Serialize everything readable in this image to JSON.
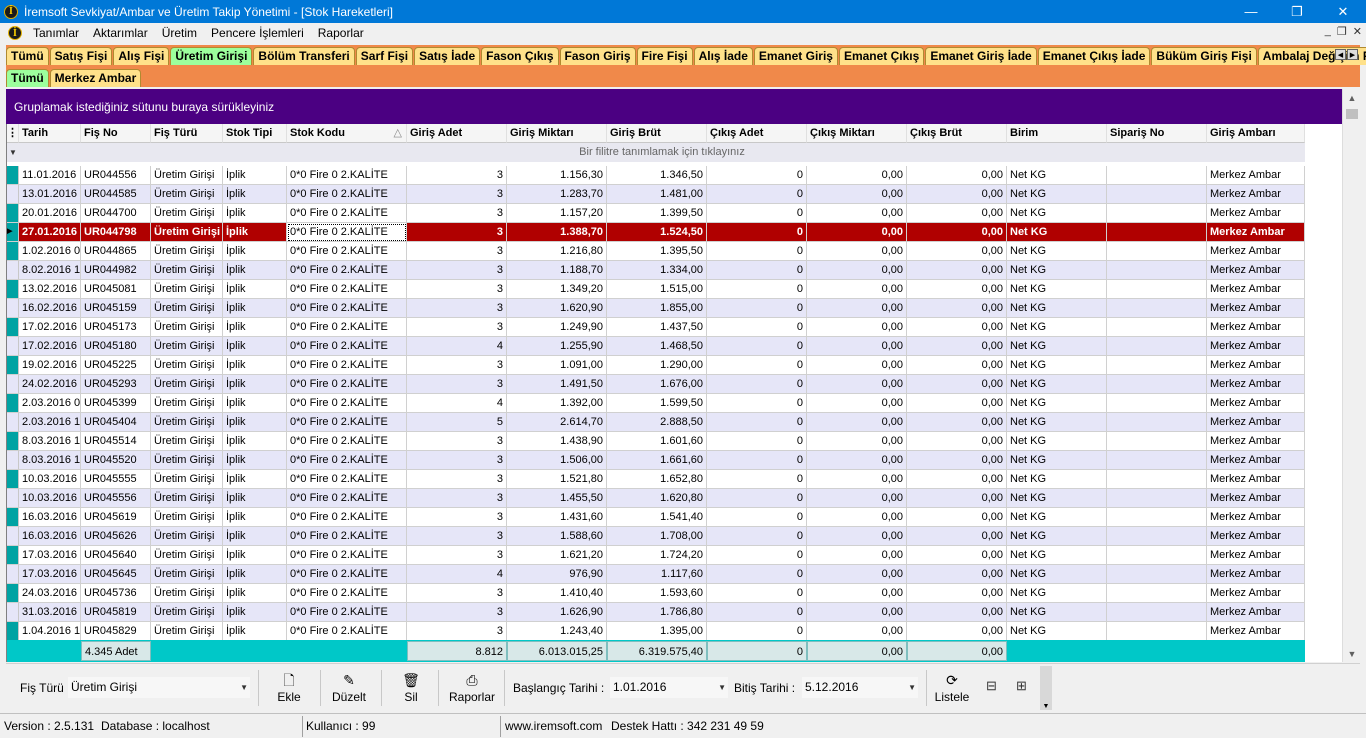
{
  "window": {
    "title": "İremsoft Sevkiyat/Ambar ve Üretim Takip Yönetimi - [Stok Hareketleri]",
    "minimize": "—",
    "maximize": "❐",
    "close": "✕"
  },
  "menu": [
    "Tanımlar",
    "Aktarımlar",
    "Üretim",
    "Pencere İşlemleri",
    "Raporlar"
  ],
  "mdi": {
    "minimize": "_",
    "restore": "❐",
    "close": "✕"
  },
  "tabs_row1": [
    "Tümü",
    "Satış Fişi",
    "Alış Fişi",
    "Üretim Girişi",
    "Bölüm Transferi",
    "Sarf Fişi",
    "Satış İade",
    "Fason Çıkış",
    "Fason Giriş",
    "Fire Fişi",
    "Alış İade",
    "Emanet Giriş",
    "Emanet Çıkış",
    "Emanet Giriş İade",
    "Emanet Çıkış İade",
    "Büküm Giriş Fişi",
    "Ambalaj Değişim Fişi"
  ],
  "tabs_row1_active": 3,
  "tabs_row2": [
    "Tümü",
    "Merkez Ambar"
  ],
  "tabs_row2_active": 0,
  "group_panel": "Gruplamak istediğiniz sütunu buraya sürükleyiniz",
  "filter_text": "Bir filitre tanımlamak için tıklayınız",
  "columns": [
    "Tarih",
    "Fiş No",
    "Fiş Türü",
    "Stok Tipi",
    "Stok Kodu",
    "Giriş Adet",
    "Giriş Miktarı",
    "Giriş Brüt",
    "Çıkış Adet",
    "Çıkış Miktarı",
    "Çıkış Brüt",
    "Birim",
    "Sipariş No",
    "Giriş Ambarı"
  ],
  "sort_indicator": "△",
  "selected_row": 3,
  "rows": [
    [
      "11.01.2016",
      "UR044556",
      "Üretim Girişi",
      "İplik",
      "0*0 Fire 0 2.KALİTE",
      "3",
      "1.156,30",
      "1.346,50",
      "0",
      "0,00",
      "0,00",
      "Net KG",
      "",
      "Merkez Ambar"
    ],
    [
      "13.01.2016",
      "UR044585",
      "Üretim Girişi",
      "İplik",
      "0*0 Fire 0 2.KALİTE",
      "3",
      "1.283,70",
      "1.481,00",
      "0",
      "0,00",
      "0,00",
      "Net KG",
      "",
      "Merkez Ambar"
    ],
    [
      "20.01.2016",
      "UR044700",
      "Üretim Girişi",
      "İplik",
      "0*0 Fire 0 2.KALİTE",
      "3",
      "1.157,20",
      "1.399,50",
      "0",
      "0,00",
      "0,00",
      "Net KG",
      "",
      "Merkez Ambar"
    ],
    [
      "27.01.2016",
      "UR044798",
      "Üretim Girişi",
      "İplik",
      "0*0 Fire 0 2.KALİTE",
      "3",
      "1.388,70",
      "1.524,50",
      "0",
      "0,00",
      "0,00",
      "Net KG",
      "",
      "Merkez Ambar"
    ],
    [
      "1.02.2016 0",
      "UR044865",
      "Üretim Girişi",
      "İplik",
      "0*0 Fire 0 2.KALİTE",
      "3",
      "1.216,80",
      "1.395,50",
      "0",
      "0,00",
      "0,00",
      "Net KG",
      "",
      "Merkez Ambar"
    ],
    [
      "8.02.2016 1",
      "UR044982",
      "Üretim Girişi",
      "İplik",
      "0*0 Fire 0 2.KALİTE",
      "3",
      "1.188,70",
      "1.334,00",
      "0",
      "0,00",
      "0,00",
      "Net KG",
      "",
      "Merkez Ambar"
    ],
    [
      "13.02.2016",
      "UR045081",
      "Üretim Girişi",
      "İplik",
      "0*0 Fire 0 2.KALİTE",
      "3",
      "1.349,20",
      "1.515,00",
      "0",
      "0,00",
      "0,00",
      "Net KG",
      "",
      "Merkez Ambar"
    ],
    [
      "16.02.2016",
      "UR045159",
      "Üretim Girişi",
      "İplik",
      "0*0 Fire 0 2.KALİTE",
      "3",
      "1.620,90",
      "1.855,00",
      "0",
      "0,00",
      "0,00",
      "Net KG",
      "",
      "Merkez Ambar"
    ],
    [
      "17.02.2016",
      "UR045173",
      "Üretim Girişi",
      "İplik",
      "0*0 Fire 0 2.KALİTE",
      "3",
      "1.249,90",
      "1.437,50",
      "0",
      "0,00",
      "0,00",
      "Net KG",
      "",
      "Merkez Ambar"
    ],
    [
      "17.02.2016",
      "UR045180",
      "Üretim Girişi",
      "İplik",
      "0*0 Fire 0 2.KALİTE",
      "4",
      "1.255,90",
      "1.468,50",
      "0",
      "0,00",
      "0,00",
      "Net KG",
      "",
      "Merkez Ambar"
    ],
    [
      "19.02.2016",
      "UR045225",
      "Üretim Girişi",
      "İplik",
      "0*0 Fire 0 2.KALİTE",
      "3",
      "1.091,00",
      "1.290,00",
      "0",
      "0,00",
      "0,00",
      "Net KG",
      "",
      "Merkez Ambar"
    ],
    [
      "24.02.2016",
      "UR045293",
      "Üretim Girişi",
      "İplik",
      "0*0 Fire 0 2.KALİTE",
      "3",
      "1.491,50",
      "1.676,00",
      "0",
      "0,00",
      "0,00",
      "Net KG",
      "",
      "Merkez Ambar"
    ],
    [
      "2.03.2016 0",
      "UR045399",
      "Üretim Girişi",
      "İplik",
      "0*0 Fire 0 2.KALİTE",
      "4",
      "1.392,00",
      "1.599,50",
      "0",
      "0,00",
      "0,00",
      "Net KG",
      "",
      "Merkez Ambar"
    ],
    [
      "2.03.2016 1",
      "UR045404",
      "Üretim Girişi",
      "İplik",
      "0*0 Fire 0 2.KALİTE",
      "5",
      "2.614,70",
      "2.888,50",
      "0",
      "0,00",
      "0,00",
      "Net KG",
      "",
      "Merkez Ambar"
    ],
    [
      "8.03.2016 1",
      "UR045514",
      "Üretim Girişi",
      "İplik",
      "0*0 Fire 0 2.KALİTE",
      "3",
      "1.438,90",
      "1.601,60",
      "0",
      "0,00",
      "0,00",
      "Net KG",
      "",
      "Merkez Ambar"
    ],
    [
      "8.03.2016 1",
      "UR045520",
      "Üretim Girişi",
      "İplik",
      "0*0 Fire 0 2.KALİTE",
      "3",
      "1.506,00",
      "1.661,60",
      "0",
      "0,00",
      "0,00",
      "Net KG",
      "",
      "Merkez Ambar"
    ],
    [
      "10.03.2016",
      "UR045555",
      "Üretim Girişi",
      "İplik",
      "0*0 Fire 0 2.KALİTE",
      "3",
      "1.521,80",
      "1.652,80",
      "0",
      "0,00",
      "0,00",
      "Net KG",
      "",
      "Merkez Ambar"
    ],
    [
      "10.03.2016",
      "UR045556",
      "Üretim Girişi",
      "İplik",
      "0*0 Fire 0 2.KALİTE",
      "3",
      "1.455,50",
      "1.620,80",
      "0",
      "0,00",
      "0,00",
      "Net KG",
      "",
      "Merkez Ambar"
    ],
    [
      "16.03.2016",
      "UR045619",
      "Üretim Girişi",
      "İplik",
      "0*0 Fire 0 2.KALİTE",
      "3",
      "1.431,60",
      "1.541,40",
      "0",
      "0,00",
      "0,00",
      "Net KG",
      "",
      "Merkez Ambar"
    ],
    [
      "16.03.2016",
      "UR045626",
      "Üretim Girişi",
      "İplik",
      "0*0 Fire 0 2.KALİTE",
      "3",
      "1.588,60",
      "1.708,00",
      "0",
      "0,00",
      "0,00",
      "Net KG",
      "",
      "Merkez Ambar"
    ],
    [
      "17.03.2016",
      "UR045640",
      "Üretim Girişi",
      "İplik",
      "0*0 Fire 0 2.KALİTE",
      "3",
      "1.621,20",
      "1.724,20",
      "0",
      "0,00",
      "0,00",
      "Net KG",
      "",
      "Merkez Ambar"
    ],
    [
      "17.03.2016",
      "UR045645",
      "Üretim Girişi",
      "İplik",
      "0*0 Fire 0 2.KALİTE",
      "4",
      "976,90",
      "1.117,60",
      "0",
      "0,00",
      "0,00",
      "Net KG",
      "",
      "Merkez Ambar"
    ],
    [
      "24.03.2016",
      "UR045736",
      "Üretim Girişi",
      "İplik",
      "0*0 Fire 0 2.KALİTE",
      "3",
      "1.410,40",
      "1.593,60",
      "0",
      "0,00",
      "0,00",
      "Net KG",
      "",
      "Merkez Ambar"
    ],
    [
      "31.03.2016",
      "UR045819",
      "Üretim Girişi",
      "İplik",
      "0*0 Fire 0 2.KALİTE",
      "3",
      "1.626,90",
      "1.786,80",
      "0",
      "0,00",
      "0,00",
      "Net KG",
      "",
      "Merkez Ambar"
    ],
    [
      "1.04.2016 1",
      "UR045829",
      "Üretim Girişi",
      "İplik",
      "0*0 Fire 0 2.KALİTE",
      "3",
      "1.243,40",
      "1.395,00",
      "0",
      "0,00",
      "0,00",
      "Net KG",
      "",
      "Merkez Ambar"
    ]
  ],
  "footer": {
    "count": "4.345 Adet",
    "giris_adet": "8.812",
    "giris_miktari": "6.013.015,25",
    "giris_brut": "6.319.575,40",
    "cikis_adet": "0",
    "cikis_miktari": "0,00",
    "cikis_brut": "0,00"
  },
  "toolbar": {
    "fis_turu_label": "Fiş Türü",
    "fis_turu_value": "Üretim Girişi",
    "ekle": "Ekle",
    "duzelt": "Düzelt",
    "sil": "Sil",
    "raporlar": "Raporlar",
    "baslangic_label": "Başlangıç Tarihi :",
    "baslangic_value": "1.01.2016",
    "bitis_label": "Bitiş Tarihi :",
    "bitis_value": "5.12.2016",
    "listele": "Listele"
  },
  "status": {
    "version": "Version : 2.5.131",
    "database": "Database : localhost",
    "user": "Kullanıcı : 99",
    "site": "www.iremsoft.com",
    "destek": "Destek Hattı : 342 231 49 59"
  },
  "colors": {
    "title_blue": "#0078d7",
    "tabs_orange": "#f0894a",
    "tab_yellow": "#ffe18a",
    "tab_active": "#9cff9c",
    "group_purple": "#4b0082",
    "indicator_teal": "#00a3a3",
    "selected_red": "#b00000",
    "alt_row": "#e6e6f8",
    "footer_cyan": "#00c8c8"
  }
}
